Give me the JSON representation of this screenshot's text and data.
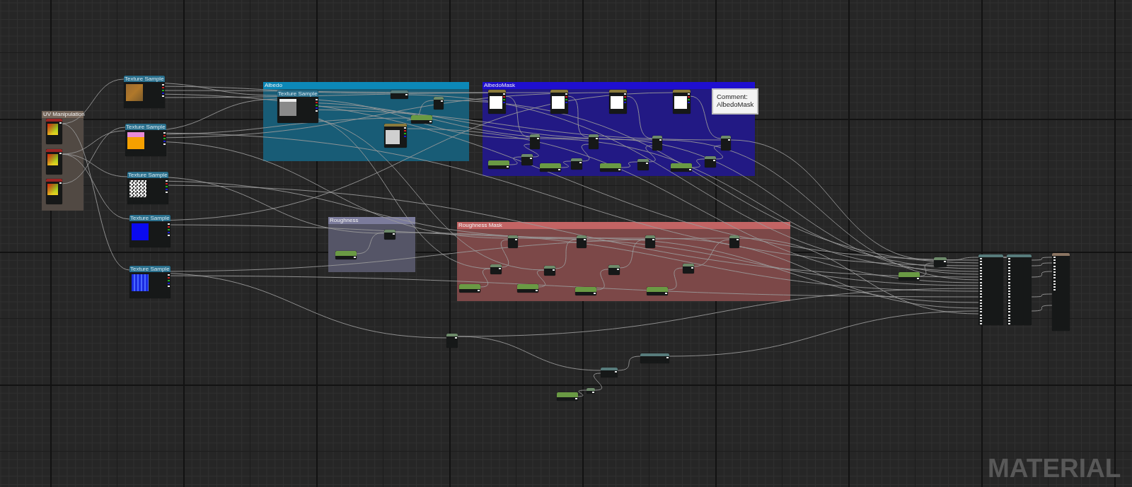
{
  "comments": [
    {
      "title": "UV Manipulation",
      "color": "#75665a"
    },
    {
      "title": "Albedo",
      "color": "#0c88b8"
    },
    {
      "title": "AlbedoMask",
      "color": "#1f0fd0"
    },
    {
      "title": "Roughness",
      "color": "#7c7c9c"
    },
    {
      "title": "Roughness Mask",
      "color": "#c26464"
    }
  ],
  "note": {
    "text": "Comment: AlbedoMask"
  },
  "texture_samples": [
    {
      "title": "Texture Sample",
      "kind": "rust"
    },
    {
      "title": "Texture Sample",
      "kind": "pinkorange"
    },
    {
      "title": "Texture Sample",
      "kind": "noise"
    },
    {
      "title": "Texture Sample",
      "kind": "blue"
    },
    {
      "title": "Texture Sample",
      "kind": "tiles"
    },
    {
      "title": "Texture Sample",
      "kind": "gray"
    }
  ],
  "graph_label": "MATERIAL"
}
